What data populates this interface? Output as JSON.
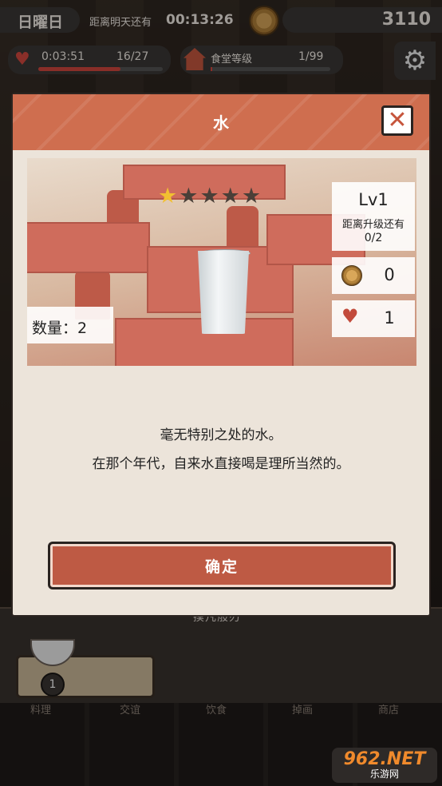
{
  "hud": {
    "day": "日曜日",
    "until_label": "距离明天还有",
    "time_left": "00:13:26",
    "coins": "3110",
    "heart_timer": "0:03:51",
    "heart_count": "16/27",
    "heart_fill_fraction": 0.66,
    "shop_label": "食堂等级",
    "shop_level": "1/99",
    "shop_fill_fraction": 0.01
  },
  "background": {
    "behind_text": "摸凡般刃",
    "bottom_tabs": [
      "料理",
      "交谊",
      "饮食",
      "掉画",
      "商店"
    ],
    "plate_count": "1"
  },
  "modal": {
    "title": "水",
    "stars_total": 5,
    "stars_on": 1,
    "level": "Lv1",
    "level_until": "距离升级还有",
    "level_progress": "0/2",
    "coin_value": "0",
    "heart_value": "1",
    "quantity": "数量：2",
    "description_1": "毫无特别之处的水。",
    "description_2": "在那个年代，自来水直接喝是理所当然的。",
    "confirm_label": "确定"
  },
  "watermark": {
    "big": "962.NET",
    "small": "乐游网"
  }
}
